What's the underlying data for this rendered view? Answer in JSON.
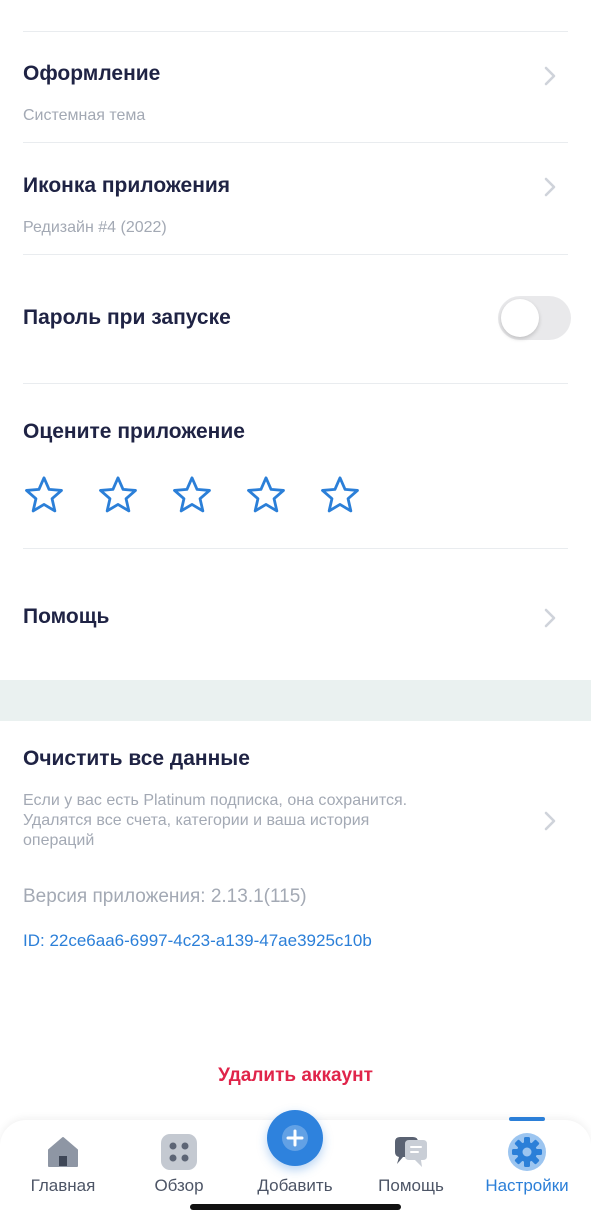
{
  "appearance": {
    "title": "Оформление",
    "value": "Системная тема"
  },
  "app_icon": {
    "title": "Иконка приложения",
    "value": "Редизайн #4 (2022)"
  },
  "launch_password": {
    "title": "Пароль при запуске",
    "enabled": false
  },
  "rate": {
    "title": "Оцените приложение",
    "stars_total": 5,
    "rating": 0
  },
  "help": {
    "title": "Помощь"
  },
  "clear_data": {
    "title": "Очистить все данные",
    "description": "Если у вас есть Platinum подписка, она сохранится. Удалятся все счета, категории и ваша история операций"
  },
  "version": "Версия приложения: 2.13.1(115)",
  "device_id": "ID: 22ce6aa6-6997-4c23-a139-47ae3925c10b",
  "delete_account": "Удалить аккаунт",
  "tabbar": {
    "tabs": [
      {
        "label": "Главная",
        "icon": "house-icon"
      },
      {
        "label": "Обзор",
        "icon": "grid-icon"
      },
      {
        "label": "Добавить",
        "icon": "plus-icon"
      },
      {
        "label": "Помощь",
        "icon": "chat-icon"
      },
      {
        "label": "Настройки",
        "icon": "gear-icon",
        "active": true
      }
    ]
  },
  "colors": {
    "accent": "#2b7fd8",
    "danger": "#e0244a",
    "title_text": "#1f2344",
    "secondary_text": "#a3a9b4",
    "section_band": "#eaf1f0"
  }
}
